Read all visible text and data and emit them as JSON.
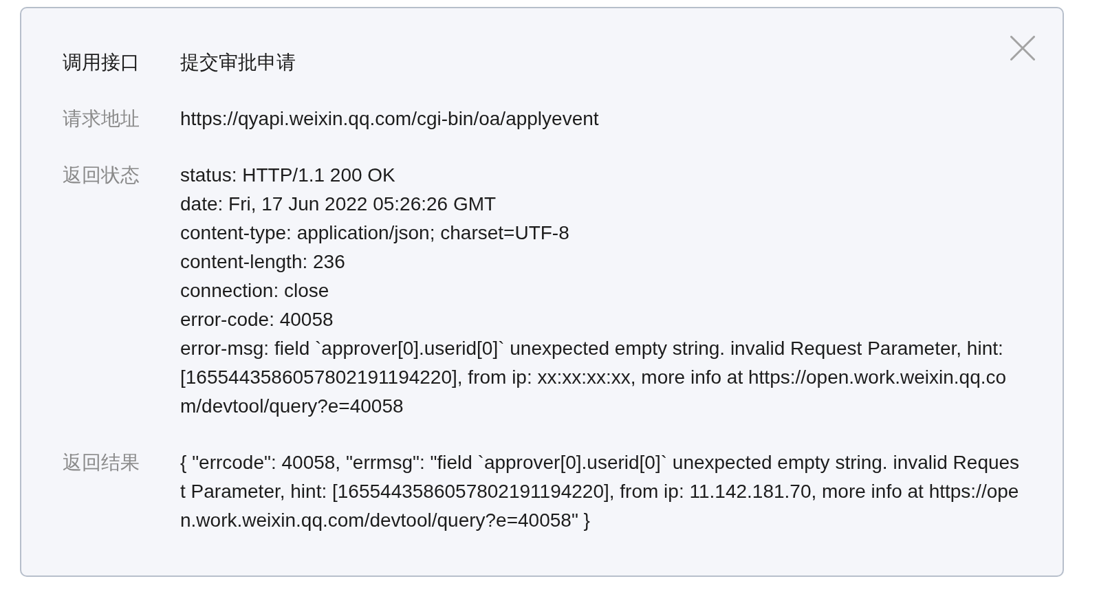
{
  "dialog": {
    "api": {
      "label": "调用接口",
      "value": "提交审批申请"
    },
    "fields": [
      {
        "label": "请求地址",
        "lines": [
          "https://qyapi.weixin.qq.com/cgi-bin/oa/applyevent"
        ]
      },
      {
        "label": "返回状态",
        "lines": [
          "status: HTTP/1.1 200 OK",
          "date: Fri, 17 Jun 2022 05:26:26 GMT",
          "content-type: application/json; charset=UTF-8",
          "content-length: 236",
          "connection: close",
          "error-code: 40058",
          "error-msg: field `approver[0].userid[0]` unexpected empty string. invalid Request Parameter, hint: [1655443586057802191194220], from ip: xx:xx:xx:xx, more info at https://open.work.weixin.qq.com/devtool/query?e=40058"
        ]
      },
      {
        "label": "返回结果",
        "lines": [
          "{ \"errcode\": 40058, \"errmsg\": \"field `approver[0].userid[0]` unexpected empty string. invalid Request Parameter, hint: [1655443586057802191194220], from ip: 11.142.181.70, more info at https://open.work.weixin.qq.com/devtool/query?e=40058\" }"
        ]
      }
    ]
  }
}
